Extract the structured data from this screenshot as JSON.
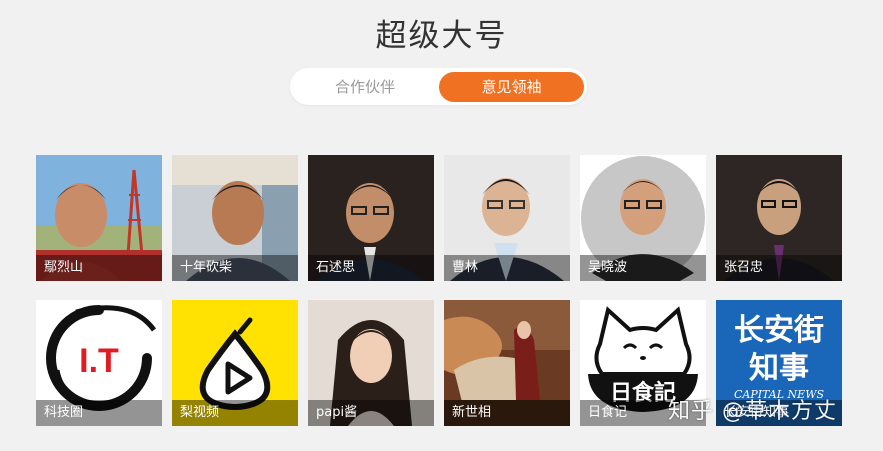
{
  "header": {
    "title": "超级大号"
  },
  "tabs": [
    {
      "label": "合作伙伴",
      "active": false
    },
    {
      "label": "意见领袖",
      "active": true
    }
  ],
  "accent_color": "#ef7121",
  "accounts_row1": [
    {
      "name": "鄢烈山"
    },
    {
      "name": "十年砍柴"
    },
    {
      "name": "石述思"
    },
    {
      "name": "曹林"
    },
    {
      "name": "吴晓波"
    },
    {
      "name": "张召忠"
    }
  ],
  "accounts_row2": [
    {
      "name": "科技圈"
    },
    {
      "name": "梨视频"
    },
    {
      "name": "papi酱"
    },
    {
      "name": "新世相"
    },
    {
      "name": "日食记"
    },
    {
      "name": "长安街知事"
    }
  ],
  "logos": {
    "it_logo_text": "I.T",
    "cat_logo_text": "日食記",
    "news_logo_line1": "长安街",
    "news_logo_line2": "知事",
    "news_logo_line3": "CAPITAL NEWS"
  },
  "watermark": "知乎 @草木方丈"
}
